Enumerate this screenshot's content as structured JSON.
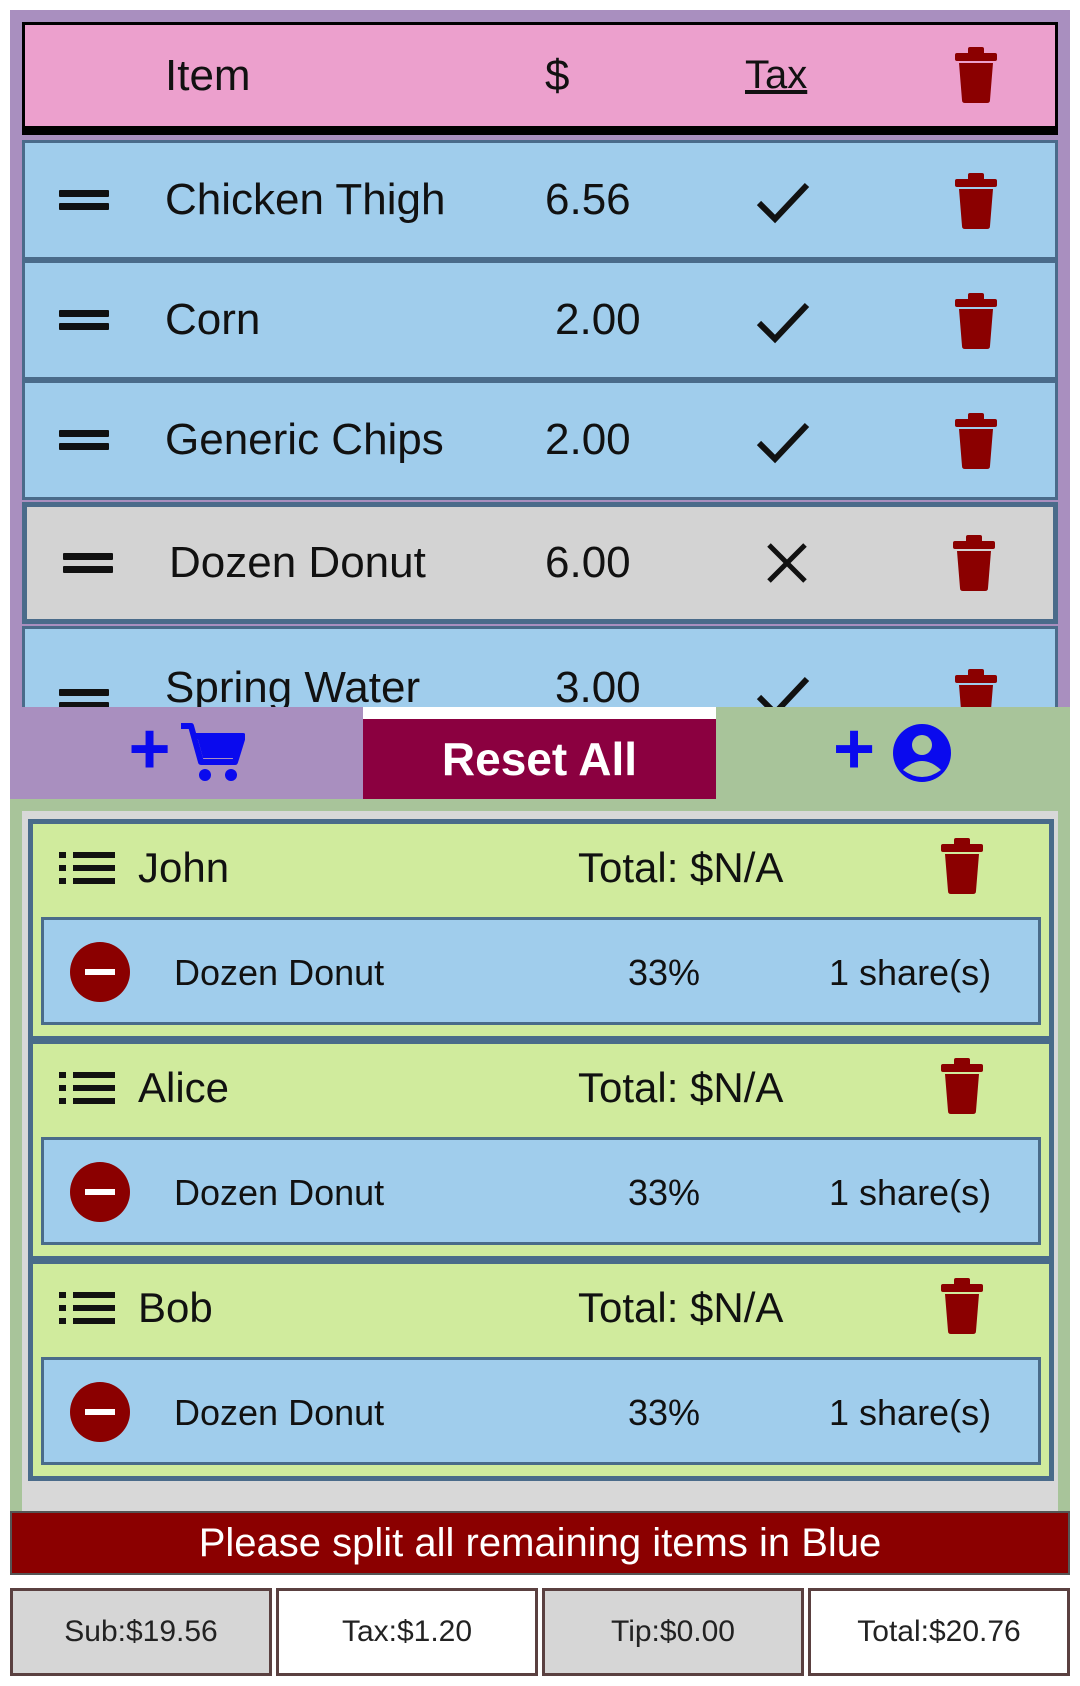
{
  "items_header": {
    "item_label": "Item",
    "price_label": "$",
    "tax_label": "Tax"
  },
  "items": [
    {
      "name": "Chicken Thigh",
      "price": "6.56",
      "taxed": true
    },
    {
      "name": "Corn",
      "price": "2.00",
      "taxed": true
    },
    {
      "name": "Generic Chips",
      "price": "2.00",
      "taxed": true
    },
    {
      "name": "Dozen Donut",
      "price": "6.00",
      "taxed": false
    },
    {
      "name": "Spring Water",
      "price": "3.00",
      "taxed": true
    }
  ],
  "actions": {
    "reset_label": "Reset All",
    "add_item_icon": "add-cart-icon",
    "add_person_icon": "add-person-icon"
  },
  "people": [
    {
      "name": "John",
      "total": "Total: $N/A",
      "shares": [
        {
          "item": "Dozen Donut",
          "percent": "33%",
          "count": "1 share(s)"
        }
      ]
    },
    {
      "name": "Alice",
      "total": "Total: $N/A",
      "shares": [
        {
          "item": "Dozen Donut",
          "percent": "33%",
          "count": "1 share(s)"
        }
      ]
    },
    {
      "name": "Bob",
      "total": "Total: $N/A",
      "shares": [
        {
          "item": "Dozen Donut",
          "percent": "33%",
          "count": "1 share(s)"
        }
      ]
    }
  ],
  "notice": "Please split all remaining items in Blue",
  "summary": {
    "sub": "Sub:$19.56",
    "tax": "Tax:$1.20",
    "tip": "Tip:$0.00",
    "total": "Total:$20.76"
  },
  "colors": {
    "header_pink": "#eca0cd",
    "item_blue": "#a0cdec",
    "untaxed_gray": "#d3d3d3",
    "person_green": "#d0eb9d",
    "reset_red": "#8b0040",
    "trash_red": "#8b0000",
    "accent_blue": "#0a0aee"
  }
}
